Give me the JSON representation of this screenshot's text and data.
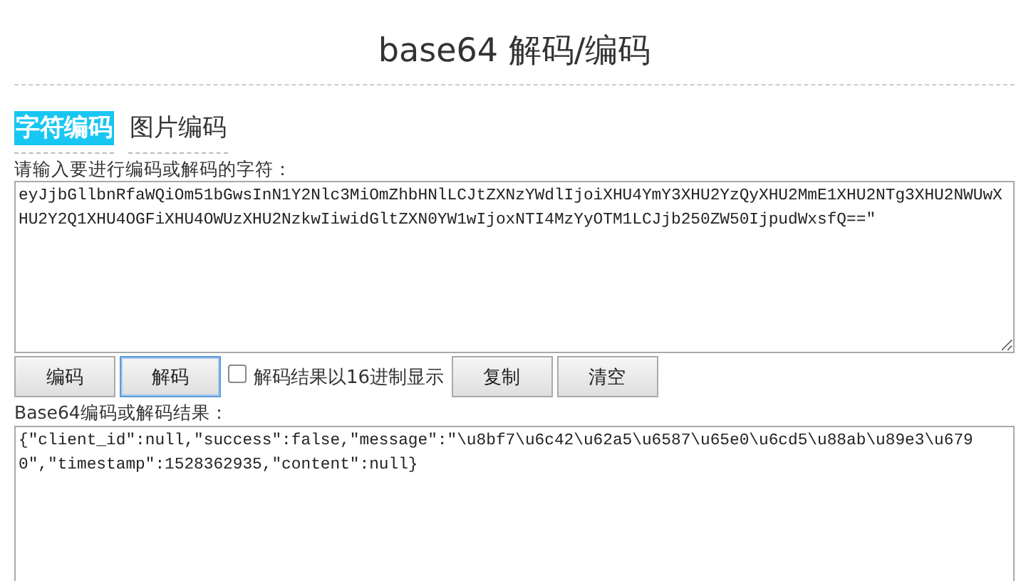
{
  "title": "base64 解码/编码",
  "tabs": [
    {
      "label": "字符编码",
      "selected": true
    },
    {
      "label": "图片编码",
      "selected": false
    }
  ],
  "input": {
    "label": "请输入要进行编码或解码的字符：",
    "value": "eyJjbGllbnRfaWQiOm51bGwsInN1Y2Nlc3MiOmZhbHNlLCJtZXNzYWdlIjoiXHU4YmY3XHU2YzQyXHU2MmE1XHU2NTg3XHU2NWUwXHU2Y2Q1XHU4OGFiXHU4OWUzXHU2NzkwIiwidGltZXN0YW1wIjoxNTI4MzYyOTM1LCJjb250ZW50IjpudWxsfQ==\""
  },
  "controls": [
    {
      "kind": "button",
      "label": "编码",
      "focused": false
    },
    {
      "kind": "button",
      "label": "解码",
      "focused": true
    },
    {
      "kind": "checkbox",
      "label": "解码结果以16进制显示",
      "checked": false
    },
    {
      "kind": "button",
      "label": "复制",
      "focused": false
    },
    {
      "kind": "button",
      "label": "清空",
      "focused": false
    }
  ],
  "output": {
    "label": "Base64编码或解码结果：",
    "value": "{\"client_id\":null,\"success\":false,\"message\":\"\\u8bf7\\u6c42\\u62a5\\u6587\\u65e0\\u6cd5\\u88ab\\u89e3\\u6790\",\"timestamp\":1528362935,\"content\":null}"
  }
}
